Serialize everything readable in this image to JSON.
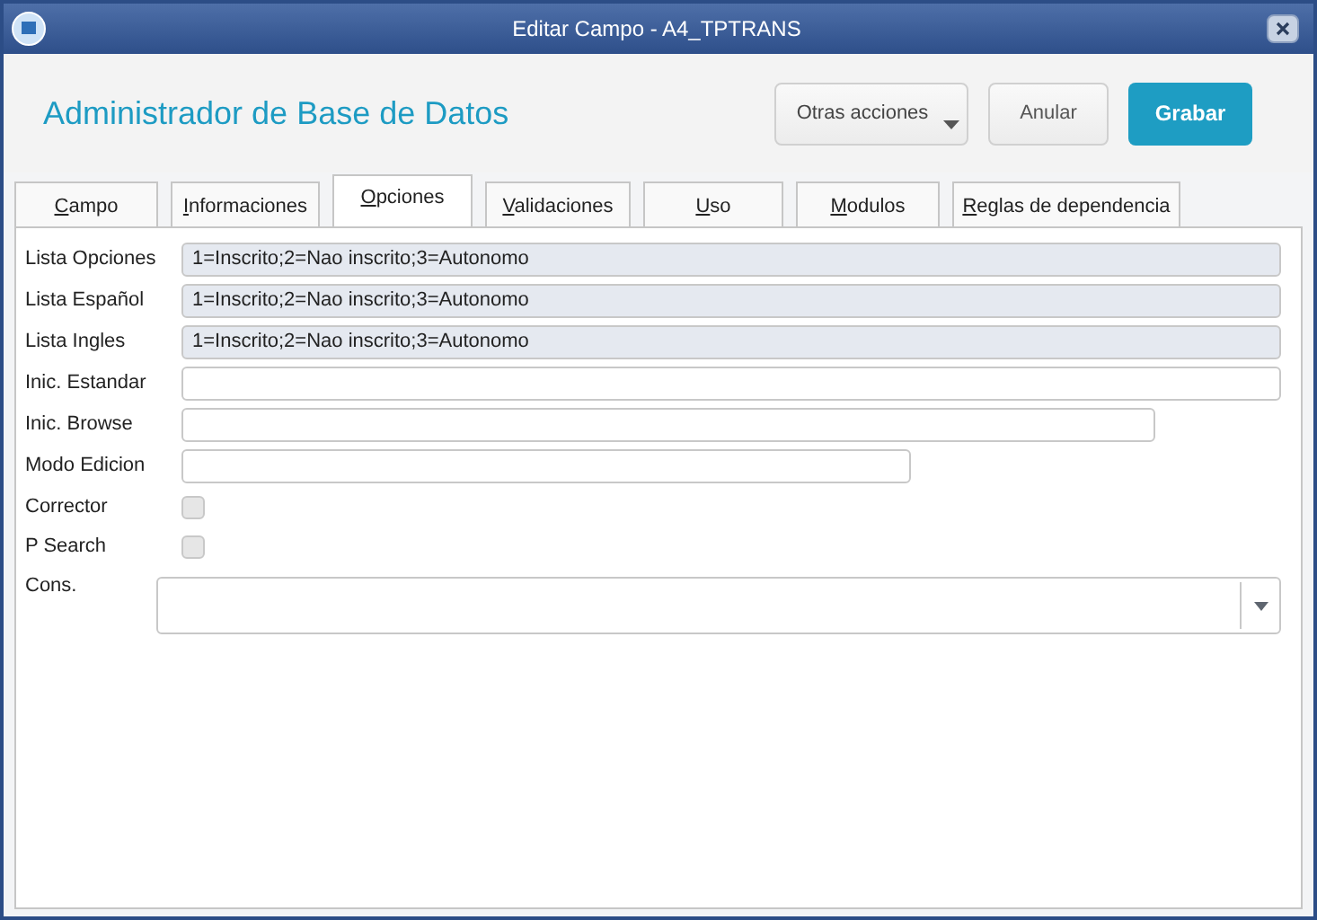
{
  "window": {
    "title": "Editar Campo - A4_TPTRANS"
  },
  "header": {
    "title": "Administrador de Base de Datos",
    "buttons": [
      {
        "label": "Otras acciones",
        "kind": "menu"
      },
      {
        "label": "Anular",
        "kind": "plain"
      },
      {
        "label": "Grabar",
        "kind": "primary"
      }
    ]
  },
  "tabs": [
    {
      "label": "Campo",
      "selected": false
    },
    {
      "label": "Informaciones",
      "selected": false
    },
    {
      "label": "Opciones",
      "selected": true
    },
    {
      "label": "Validaciones",
      "selected": false
    },
    {
      "label": "Uso",
      "selected": false
    },
    {
      "label": "Modulos",
      "selected": false
    },
    {
      "label": "Reglas de dependencia",
      "selected": false
    }
  ],
  "fields": [
    {
      "label": "Lista Opciones",
      "kind": "text",
      "disabled": true,
      "value": "1=Inscrito;2=Nao inscrito;3=Autonomo"
    },
    {
      "label": "Lista Español",
      "kind": "text",
      "disabled": true,
      "value": "1=Inscrito;2=Nao inscrito;3=Autonomo"
    },
    {
      "label": "Lista Ingles",
      "kind": "text",
      "disabled": true,
      "value": "1=Inscrito;2=Nao inscrito;3=Autonomo"
    },
    {
      "label": "Inic. Estandar",
      "kind": "text",
      "disabled": false
    },
    {
      "label": "Inic. Browse",
      "kind": "text",
      "disabled": false
    },
    {
      "label": "Modo Edicion",
      "kind": "text",
      "disabled": false
    },
    {
      "label": "Corrector",
      "kind": "checkbox",
      "checked": false
    },
    {
      "label": "P Search",
      "kind": "checkbox",
      "checked": false
    },
    {
      "label": "Cons.",
      "kind": "combo"
    }
  ]
}
